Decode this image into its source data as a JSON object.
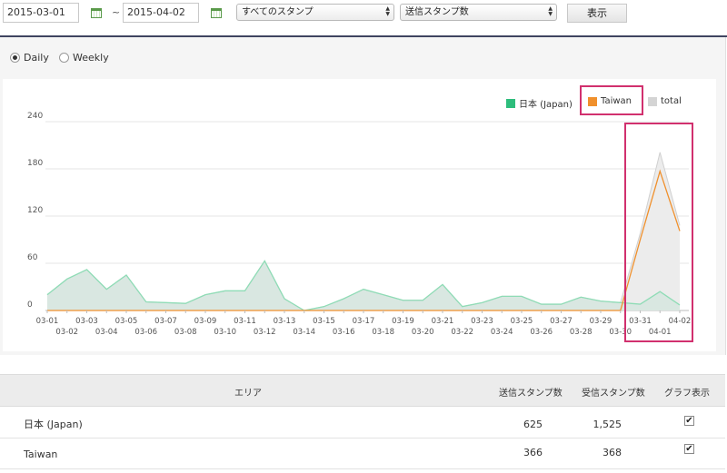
{
  "filters": {
    "start_date": "2015-03-01",
    "separator": "~",
    "end_date": "2015-04-02",
    "stamp_select": "すべてのスタンプ",
    "metric_select": "送信スタンプ数",
    "show_button": "表示"
  },
  "period": {
    "daily_label": "Daily",
    "weekly_label": "Weekly",
    "selected": "Daily"
  },
  "chart_data": {
    "type": "area",
    "title": "",
    "xlabel": "",
    "ylabel": "",
    "ylim": [
      0,
      240
    ],
    "yticks": [
      0,
      60,
      120,
      180,
      240
    ],
    "grid": true,
    "legend_position": "top-right",
    "x": [
      "03-01",
      "03-02",
      "03-03",
      "03-04",
      "03-05",
      "03-06",
      "03-07",
      "03-08",
      "03-09",
      "03-10",
      "03-11",
      "03-12",
      "03-13",
      "03-14",
      "03-15",
      "03-16",
      "03-17",
      "03-18",
      "03-19",
      "03-20",
      "03-21",
      "03-22",
      "03-23",
      "03-24",
      "03-25",
      "03-26",
      "03-27",
      "03-28",
      "03-29",
      "03-30",
      "03-31",
      "04-01",
      "04-02"
    ],
    "series": [
      {
        "name": "日本 (Japan)",
        "color": "#2ebd7c",
        "values": [
          20,
          40,
          52,
          27,
          45,
          11,
          10,
          9,
          20,
          25,
          25,
          63,
          15,
          0,
          5,
          15,
          27,
          20,
          13,
          13,
          33,
          5,
          10,
          18,
          18,
          8,
          8,
          17,
          12,
          10,
          8,
          24,
          7
        ]
      },
      {
        "name": "Taiwan",
        "color": "#f0902c",
        "values": [
          0,
          0,
          0,
          0,
          0,
          0,
          0,
          0,
          0,
          0,
          0,
          0,
          0,
          0,
          0,
          0,
          0,
          0,
          0,
          0,
          0,
          0,
          0,
          0,
          0,
          0,
          0,
          0,
          0,
          0,
          90,
          177,
          101
        ]
      },
      {
        "name": "total",
        "color": "#d4d4d4",
        "values": [
          20,
          40,
          52,
          27,
          45,
          11,
          10,
          9,
          20,
          25,
          25,
          63,
          15,
          0,
          5,
          15,
          27,
          20,
          13,
          13,
          33,
          5,
          10,
          18,
          18,
          8,
          8,
          17,
          12,
          10,
          98,
          201,
          108
        ]
      }
    ]
  },
  "table": {
    "headers": [
      "エリア",
      "送信スタンプ数",
      "受信スタンプ数",
      "グラフ表示"
    ],
    "rows": [
      {
        "area": "日本 (Japan)",
        "sent": "625",
        "received": "1,525",
        "show": true
      },
      {
        "area": "Taiwan",
        "sent": "366",
        "received": "368",
        "show": true
      }
    ]
  }
}
